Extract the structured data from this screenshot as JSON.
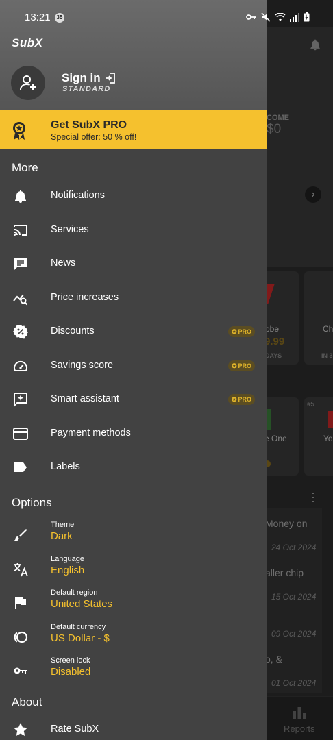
{
  "status_bar": {
    "time": "13:21",
    "badge": "35"
  },
  "background": {
    "income_label": "COME",
    "income_value": "$0",
    "cards": [
      {
        "name": "obe",
        "price": "9.99",
        "due": "DAYS"
      },
      {
        "name": "Ch",
        "price": "",
        "due": "IN 3"
      }
    ],
    "rank_cards": [
      {
        "name": "e One"
      },
      {
        "rank": "#5",
        "name": "Yo"
      }
    ],
    "news": [
      {
        "title": "Money on",
        "date": "24 Oct 2024"
      },
      {
        "title": "aller chip",
        "date": "15 Oct 2024"
      },
      {
        "title": "",
        "date": "09 Oct 2024"
      },
      {
        "title": "o, &",
        "date": "01 Oct 2024"
      }
    ],
    "bottom_tab": "Reports"
  },
  "drawer": {
    "logo": "SubX",
    "signin_label": "Sign in",
    "plan_label": "STANDARD",
    "promo": {
      "title": "Get SubX PRO",
      "subtitle": "Special offer: 50 % off!"
    },
    "more_title": "More",
    "more_items": [
      {
        "label": "Notifications",
        "icon": "bell-icon",
        "pro": false
      },
      {
        "label": "Services",
        "icon": "cast-icon",
        "pro": false
      },
      {
        "label": "News",
        "icon": "chat-icon",
        "pro": false
      },
      {
        "label": "Price increases",
        "icon": "chart-search-icon",
        "pro": false
      },
      {
        "label": "Discounts",
        "icon": "percent-badge-icon",
        "pro": true
      },
      {
        "label": "Savings score",
        "icon": "gauge-icon",
        "pro": true
      },
      {
        "label": "Smart assistant",
        "icon": "sparkle-chat-icon",
        "pro": true
      },
      {
        "label": "Payment methods",
        "icon": "credit-card-icon",
        "pro": false
      },
      {
        "label": "Labels",
        "icon": "label-icon",
        "pro": false
      }
    ],
    "pro_badge": "PRO",
    "options_title": "Options",
    "options": [
      {
        "label": "Theme",
        "value": "Dark",
        "icon": "brush-icon"
      },
      {
        "label": "Language",
        "value": "English",
        "icon": "translate-icon"
      },
      {
        "label": "Default region",
        "value": "United States",
        "icon": "flag-icon"
      },
      {
        "label": "Default currency",
        "value": "US Dollar - $",
        "icon": "currency-icon"
      },
      {
        "label": "Screen lock",
        "value": "Disabled",
        "icon": "key-icon"
      }
    ],
    "about_title": "About",
    "about_items": [
      {
        "label": "Rate SubX",
        "icon": "star-icon"
      }
    ]
  },
  "colors": {
    "accent": "#f5c12e",
    "drawer_bg": "#424242"
  }
}
